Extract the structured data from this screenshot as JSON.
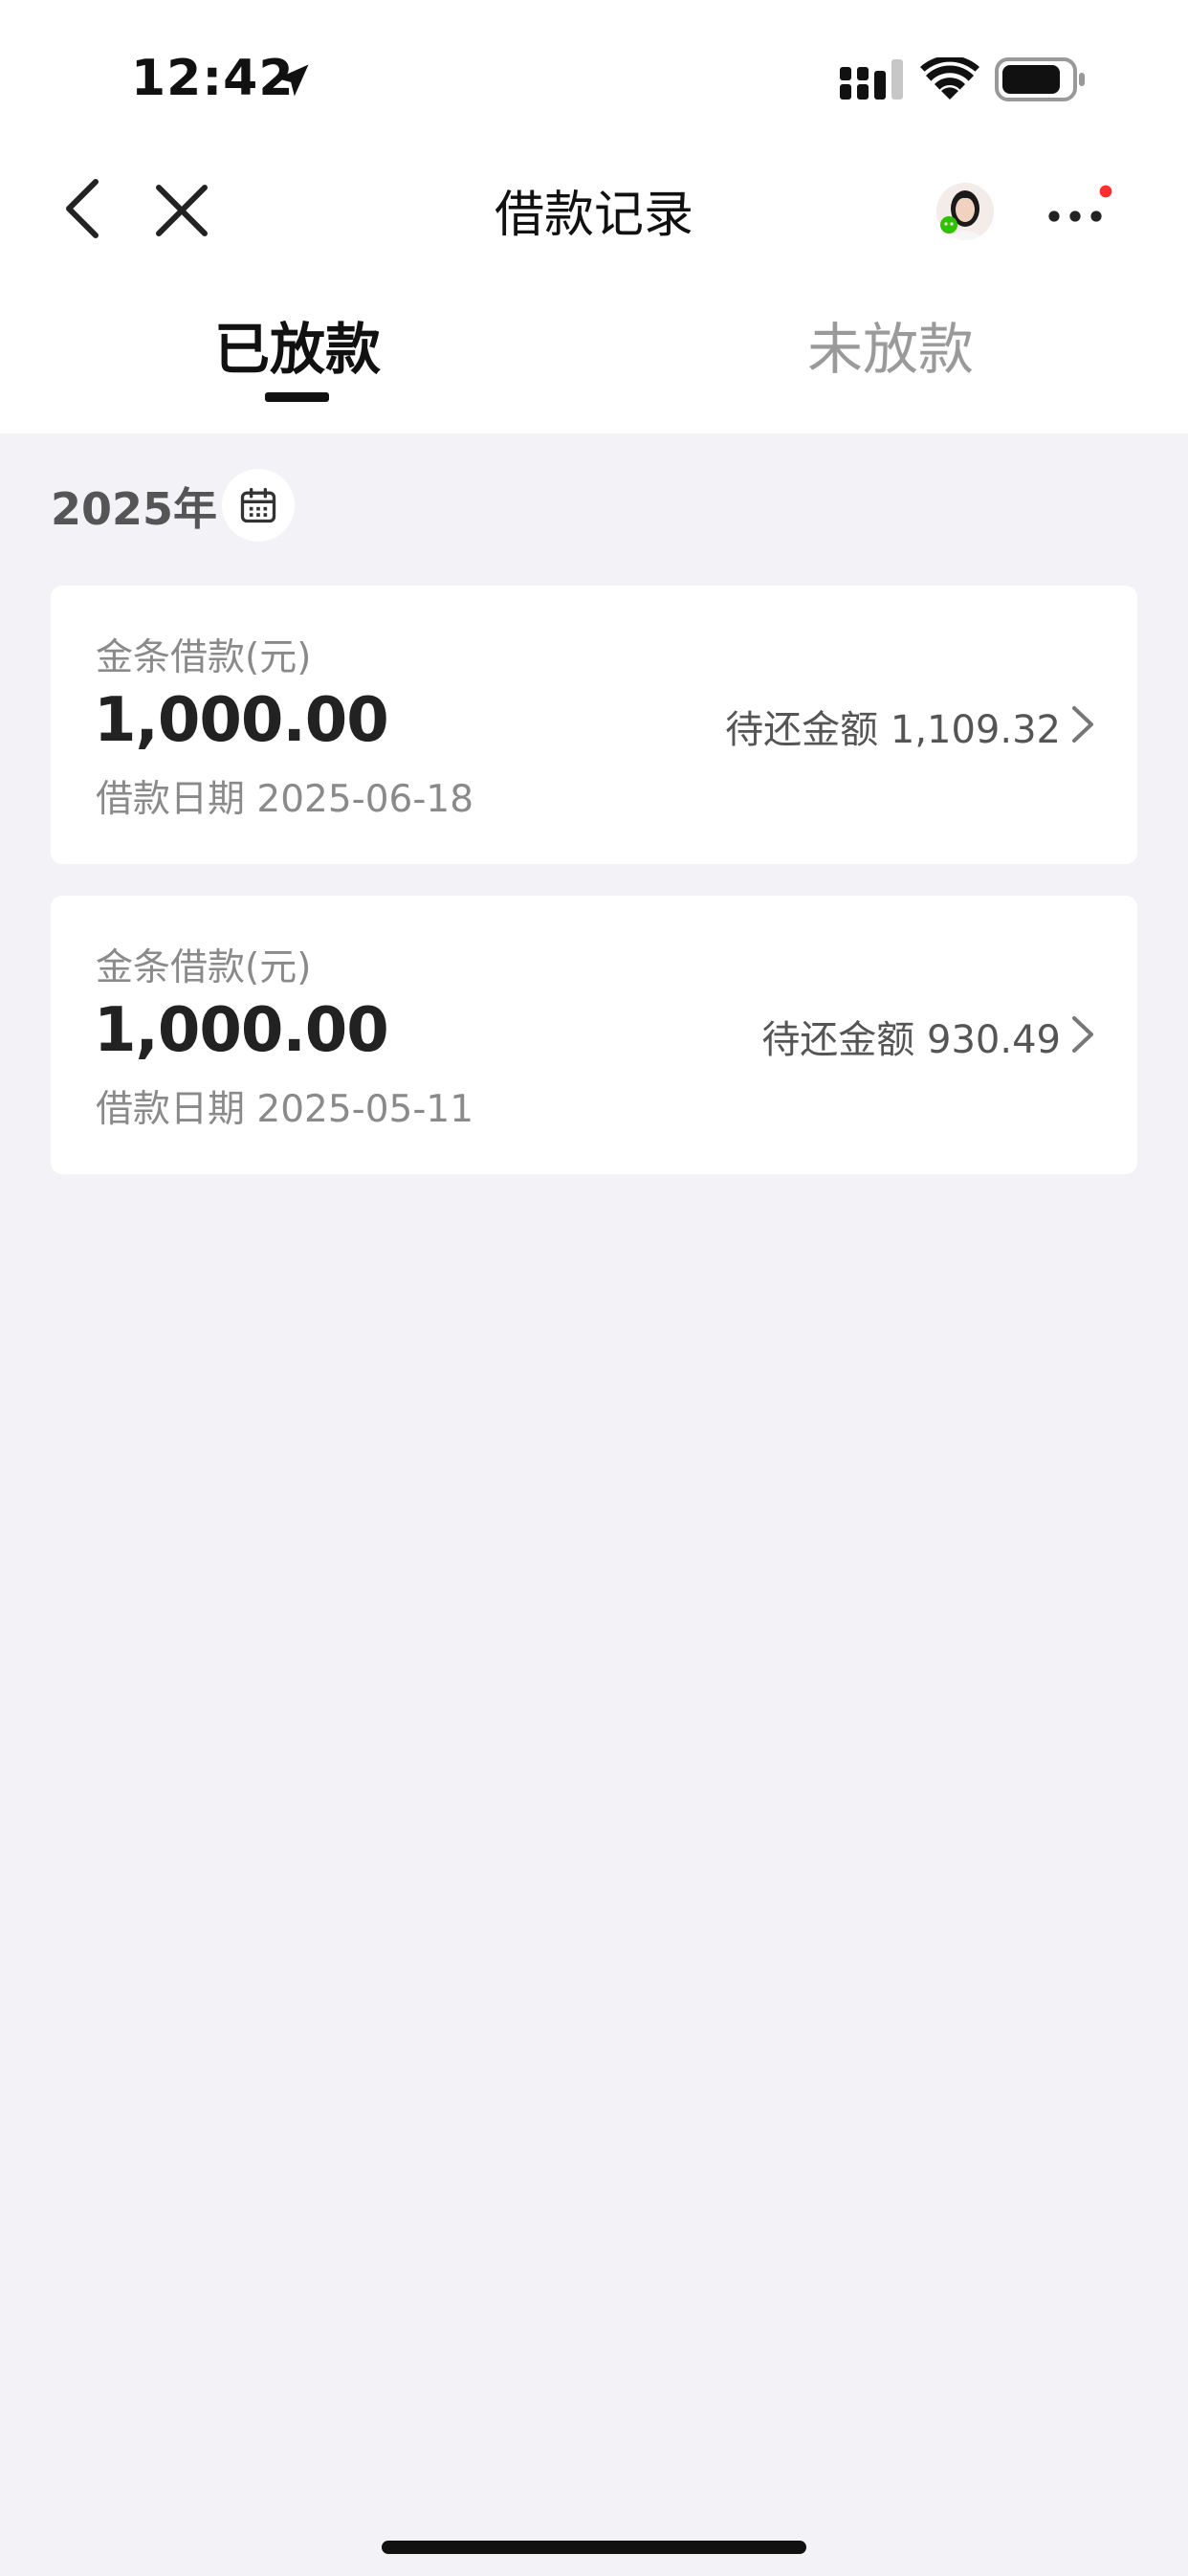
{
  "status_bar": {
    "time": "12:42"
  },
  "nav": {
    "title": "借款记录"
  },
  "tabs": [
    {
      "label": "已放款",
      "active": true
    },
    {
      "label": "未放款",
      "active": false
    }
  ],
  "year_label": "2025年",
  "loans": [
    {
      "label": "金条借款(元)",
      "amount": "1,000.00",
      "date": "借款日期 2025-06-18",
      "due": "待还金额 1,109.32"
    },
    {
      "label": "金条借款(元)",
      "amount": "1,000.00",
      "date": "借款日期 2025-05-11",
      "due": "待还金额 930.49"
    }
  ],
  "colors": {
    "background": "#f2f2f7",
    "accent_dot": "#ff2d2d",
    "wechat_green": "#2dc100"
  }
}
